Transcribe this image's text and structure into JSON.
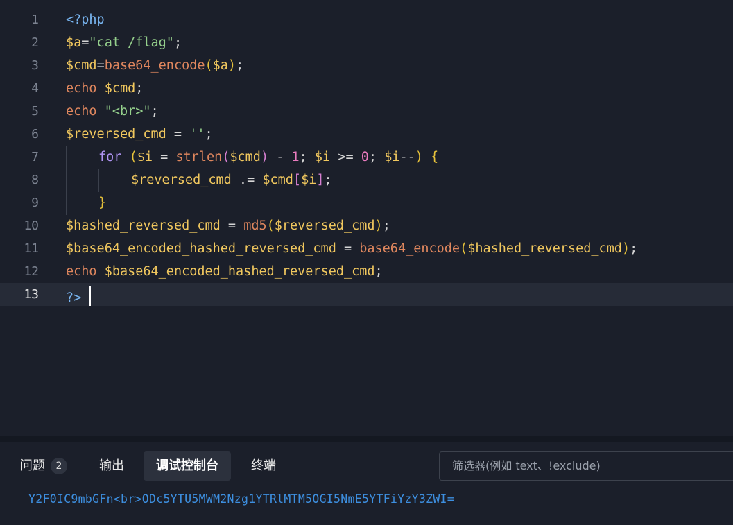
{
  "editor": {
    "line_numbers": [
      "1",
      "2",
      "3",
      "4",
      "5",
      "6",
      "7",
      "8",
      "9",
      "10",
      "11",
      "12",
      "13"
    ],
    "l1": {
      "open_tag": "<?php"
    },
    "l2": {
      "var": "$a",
      "op": "=",
      "str": "\"cat /flag\"",
      "semi": ";"
    },
    "l3": {
      "var": "$cmd",
      "op": "=",
      "fn": "base64_encode",
      "paren_open": "(",
      "arg": "$a",
      "paren_close": ")",
      "semi": ";"
    },
    "l4": {
      "kw": "echo",
      "var": "$cmd",
      "semi": ";"
    },
    "l5": {
      "kw": "echo",
      "str": "\"<br>\"",
      "semi": ";"
    },
    "l6": {
      "var": "$reversed_cmd",
      "op": " = ",
      "str": "''",
      "semi": ";"
    },
    "l7": {
      "kw": "for",
      "p1": "(",
      "v1": "$i",
      "op1": " = ",
      "fn": "strlen",
      "p2": "(",
      "v2": "$cmd",
      "p3": ")",
      "op2": " - ",
      "num1": "1",
      "s1": "; ",
      "v3": "$i",
      "op3": " >= ",
      "num2": "0",
      "s2": "; ",
      "v4": "$i",
      "op4": "--",
      "p4": ")",
      "brace": "{"
    },
    "l8": {
      "v1": "$reversed_cmd",
      "op": " .= ",
      "v2": "$cmd",
      "b1": "[",
      "v3": "$i",
      "b2": "]",
      "semi": ";"
    },
    "l9": {
      "brace": "}"
    },
    "l10": {
      "var": "$hashed_reversed_cmd",
      "op": " = ",
      "fn": "md5",
      "p1": "(",
      "arg": "$reversed_cmd",
      "p2": ")",
      "semi": ";"
    },
    "l11": {
      "var": "$base64_encoded_hashed_reversed_cmd",
      "op": " = ",
      "fn": "base64_encode",
      "p1": "(",
      "arg": "$hashed_reversed_cmd",
      "p2": ")",
      "semi": ";"
    },
    "l12": {
      "kw": "echo",
      "var": "$base64_encoded_hashed_reversed_cmd",
      "semi": ";"
    },
    "l13": {
      "close_tag": "?>"
    }
  },
  "panel": {
    "tabs": [
      {
        "label": "问题",
        "badge": "2"
      },
      {
        "label": "输出"
      },
      {
        "label": "调试控制台"
      },
      {
        "label": "终端"
      }
    ],
    "filter_placeholder": "筛选器(例如 text、!exclude)",
    "output": "Y2F0IC9mbGFn<br>ODc5YTU5MWM2Nzg1YTRlMTM5OGI5NmE5YTFiYzY3ZWI="
  },
  "colors": {
    "background": "#1b1f2a",
    "keyword": "#79b6f2",
    "variable": "#f0c75e",
    "function": "#e0875e",
    "string": "#95d08c",
    "number": "#ea7bbf",
    "output_text": "#3d8fe0"
  }
}
